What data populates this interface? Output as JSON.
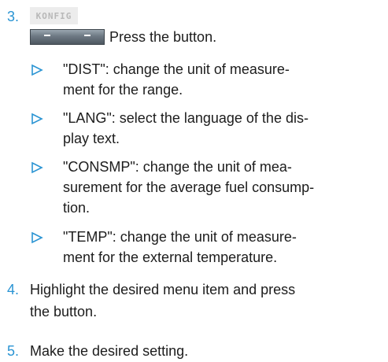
{
  "steps": [
    {
      "num": "3.",
      "display_label": "KONFIG",
      "button_text": "Press the button.",
      "bullets": [
        {
          "lines": [
            "\"DIST\": change the unit of measure-",
            "ment for the range."
          ]
        },
        {
          "lines": [
            "\"LANG\": select the language of the dis-",
            "play text."
          ]
        },
        {
          "lines": [
            "\"CONSMP\": change the unit of mea-",
            "surement for the average fuel consump-",
            "tion."
          ]
        },
        {
          "lines": [
            "\"TEMP\": change the unit of measure-",
            "ment for the external temperature."
          ]
        }
      ]
    },
    {
      "num": "4.",
      "lines": [
        "Highlight the desired menu item and press",
        "the button."
      ]
    },
    {
      "num": "5.",
      "lines": [
        "Make the desired setting."
      ]
    }
  ],
  "colors": {
    "step_number": "#2a94d3",
    "bullet_marker": "#2a94d3",
    "text": "#1c1c1c"
  },
  "icons": {
    "bullet": "triangle-right-outline-icon",
    "button": "controller-button-icon"
  }
}
